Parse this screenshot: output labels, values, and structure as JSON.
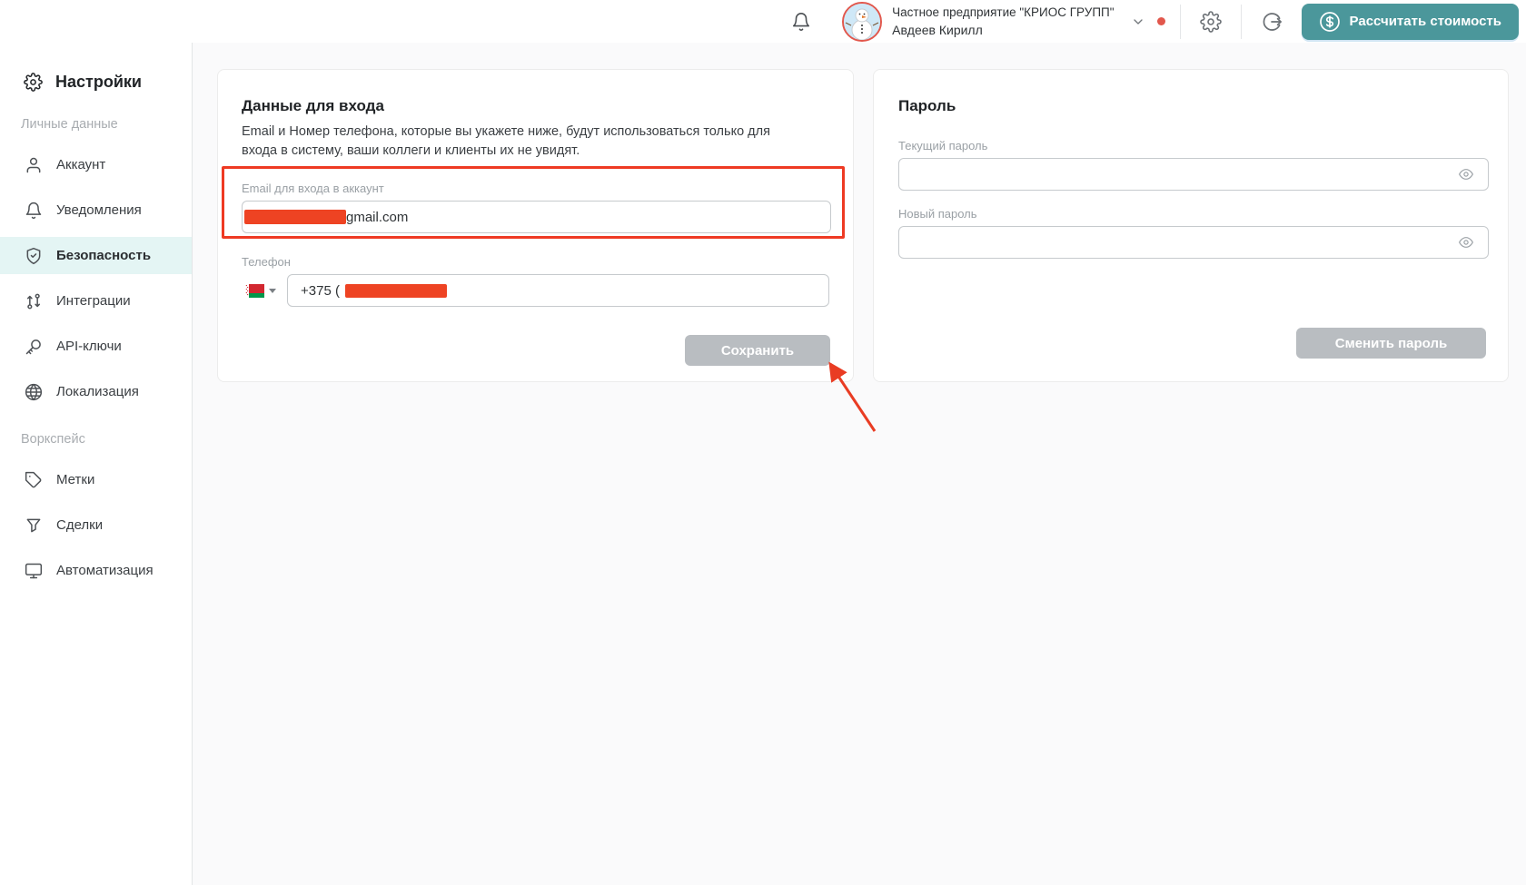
{
  "header": {
    "company": "Частное предприятие \"КРИОС ГРУПП\"",
    "user": "Авдеев Кирилл",
    "calc_button": "Рассчитать стоимость"
  },
  "sidebar": {
    "title": "Настройки",
    "sections": [
      {
        "label": "Личные данные",
        "items": [
          {
            "label": "Аккаунт",
            "icon": "user-icon",
            "active": false
          },
          {
            "label": "Уведомления",
            "icon": "bell-icon",
            "active": false
          },
          {
            "label": "Безопасность",
            "icon": "shield-check-icon",
            "active": true
          },
          {
            "label": "Интеграции",
            "icon": "integrations-icon",
            "active": false
          },
          {
            "label": "API-ключи",
            "icon": "key-icon",
            "active": false
          },
          {
            "label": "Локализация",
            "icon": "globe-icon",
            "active": false
          }
        ]
      },
      {
        "label": "Воркспейс",
        "items": [
          {
            "label": "Метки",
            "icon": "tag-icon",
            "active": false
          },
          {
            "label": "Сделки",
            "icon": "funnel-icon",
            "active": false
          },
          {
            "label": "Автоматизация",
            "icon": "monitor-icon",
            "active": false
          }
        ]
      }
    ]
  },
  "login_card": {
    "title": "Данные для входа",
    "description": "Email и Номер телефона, которые вы укажете ниже, будут использоваться только для входа в систему, ваши коллеги и клиенты их не увидят.",
    "email_label": "Email для входа в аккаунт",
    "email_visible": "gmail.com",
    "phone_label": "Телефон",
    "phone_prefix": "+375 (",
    "save_button": "Сохранить"
  },
  "password_card": {
    "title": "Пароль",
    "current_label": "Текущий пароль",
    "current_value": "",
    "new_label": "Новый пароль",
    "new_value": "",
    "change_button": "Сменить пароль"
  },
  "colors": {
    "accent_teal": "#4b979b",
    "active_item_bg": "#e4f5f4",
    "disabled_button": "#b9bdc1",
    "annotation_red": "#ee3a23",
    "redaction_red": "#ee4323",
    "notification_dot": "#e2574c"
  }
}
